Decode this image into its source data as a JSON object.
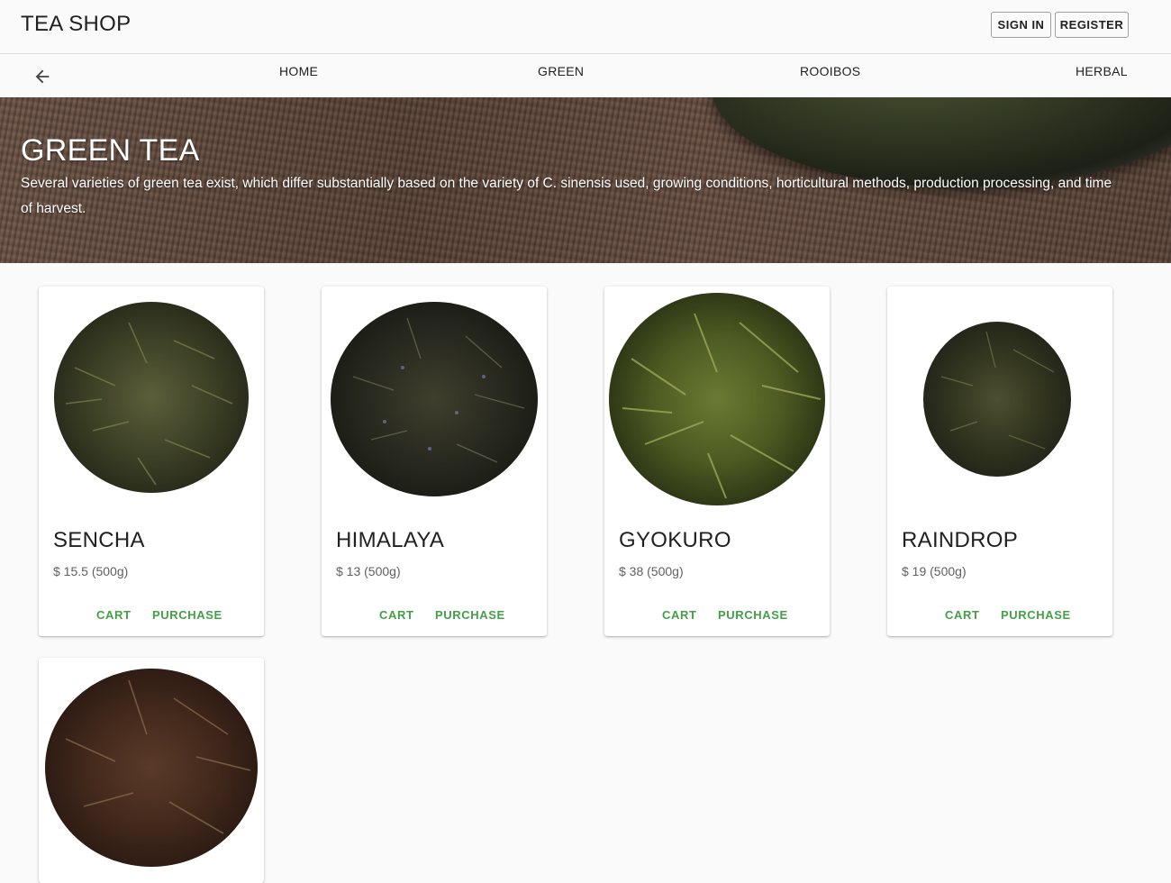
{
  "header": {
    "brand": "TEA SHOP",
    "sign_in": "SIGN IN",
    "register": "REGISTER"
  },
  "nav": {
    "items": [
      {
        "label": "HOME"
      },
      {
        "label": "GREEN"
      },
      {
        "label": "ROOIBOS"
      },
      {
        "label": "HERBAL"
      }
    ]
  },
  "hero": {
    "title": "GREEN TEA",
    "description": "Several varieties of green tea exist, which differ substantially based on the variety of C. sinensis used, growing conditions, horticultural methods, production processing, and time of harvest."
  },
  "products": [
    {
      "name": "SENCHA",
      "price": "$ 15.5 (500g)",
      "cart": "CART",
      "purchase": "PURCHASE"
    },
    {
      "name": "HIMALAYA",
      "price": "$ 13 (500g)",
      "cart": "CART",
      "purchase": "PURCHASE"
    },
    {
      "name": "GYOKURO",
      "price": "$ 38 (500g)",
      "cart": "CART",
      "purchase": "PURCHASE"
    },
    {
      "name": "RAINDROP",
      "price": "$ 19 (500g)",
      "cart": "CART",
      "purchase": "PURCHASE"
    },
    {
      "name": "",
      "price": "",
      "cart": "",
      "purchase": ""
    }
  ],
  "colors": {
    "accent": "#43a047",
    "background": "#fafafa"
  }
}
